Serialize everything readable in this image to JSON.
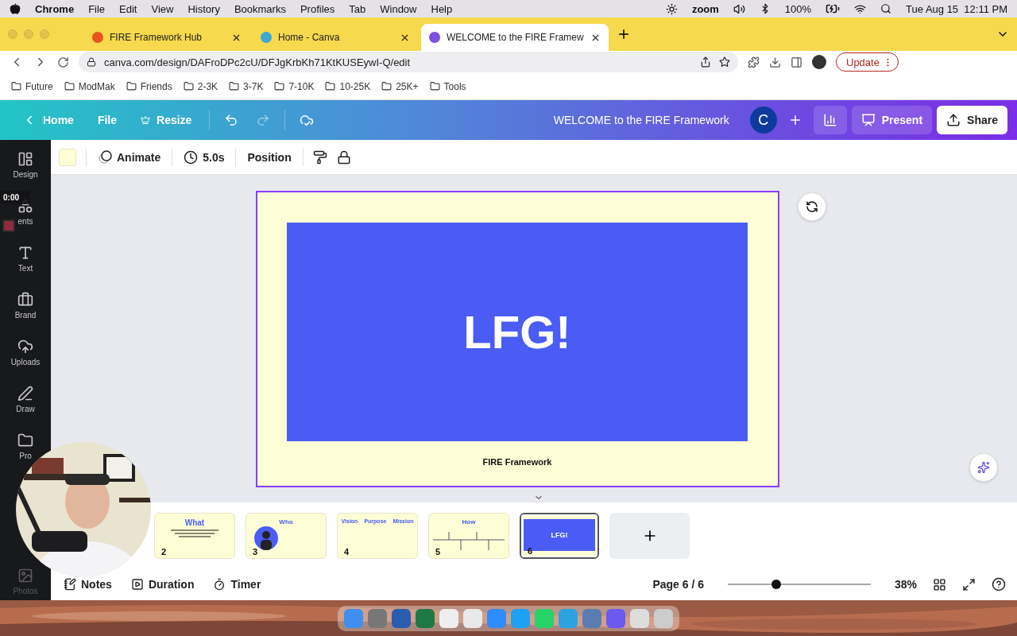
{
  "menubar": {
    "app": "Chrome",
    "menus": [
      "File",
      "Edit",
      "View",
      "History",
      "Bookmarks",
      "Profiles",
      "Tab",
      "Window",
      "Help"
    ],
    "zoom_label": "zoom",
    "battery": "100%",
    "datetime": "Tue Aug 15  12:11 PM"
  },
  "browser": {
    "tabs": [
      {
        "title": "FIRE Framework Hub",
        "selected": false
      },
      {
        "title": "Home - Canva",
        "selected": false
      },
      {
        "title": "WELCOME to the FIRE Framew",
        "selected": true
      }
    ],
    "url": "canva.com/design/DAFroDPc2cU/DFJgKrbKh71KtKUSEywI-Q/edit",
    "update_label": "Update",
    "bookmarks": [
      "Future",
      "ModMak",
      "Friends",
      "2-3K",
      "3-7K",
      "7-10K",
      "10-25K",
      "25K+",
      "Tools"
    ]
  },
  "header": {
    "home": "Home",
    "file": "File",
    "resize": "Resize",
    "title": "WELCOME to the FIRE Framework",
    "avatar": "C",
    "present": "Present",
    "share": "Share"
  },
  "toolbar": {
    "animate": "Animate",
    "duration": "5.0s",
    "position": "Position"
  },
  "sidebar": [
    {
      "label": "Design",
      "kind": "design"
    },
    {
      "label": "ents",
      "kind": "elements"
    },
    {
      "label": "Text",
      "kind": "text"
    },
    {
      "label": "Brand",
      "kind": "brand"
    },
    {
      "label": "Uploads",
      "kind": "uploads"
    },
    {
      "label": "Draw",
      "kind": "draw"
    },
    {
      "label": "Pro",
      "kind": "projects"
    },
    {
      "label": "Photos",
      "kind": "photos"
    }
  ],
  "recorder": {
    "time": "0:00"
  },
  "slide": {
    "headline": "LFG!",
    "footer": "FIRE Framework"
  },
  "pages": [
    {
      "number": "2",
      "kind": "title",
      "headings": [
        "What"
      ],
      "selected": false
    },
    {
      "number": "3",
      "kind": "profile",
      "headings": [
        "Who"
      ],
      "selected": false
    },
    {
      "number": "4",
      "kind": "columns",
      "headings": [
        "Vision",
        "Purpose",
        "Mission"
      ],
      "selected": false
    },
    {
      "number": "5",
      "kind": "grid",
      "headings": [
        "How"
      ],
      "selected": false
    },
    {
      "number": "6",
      "kind": "banner",
      "headings": [
        "LFG!"
      ],
      "selected": true
    }
  ],
  "footer": {
    "notes": "Notes",
    "duration": "Duration",
    "timer": "Timer",
    "page": "Page 6 / 6",
    "zoom_slider": {
      "level": 0.34
    },
    "zoom": "38%"
  }
}
